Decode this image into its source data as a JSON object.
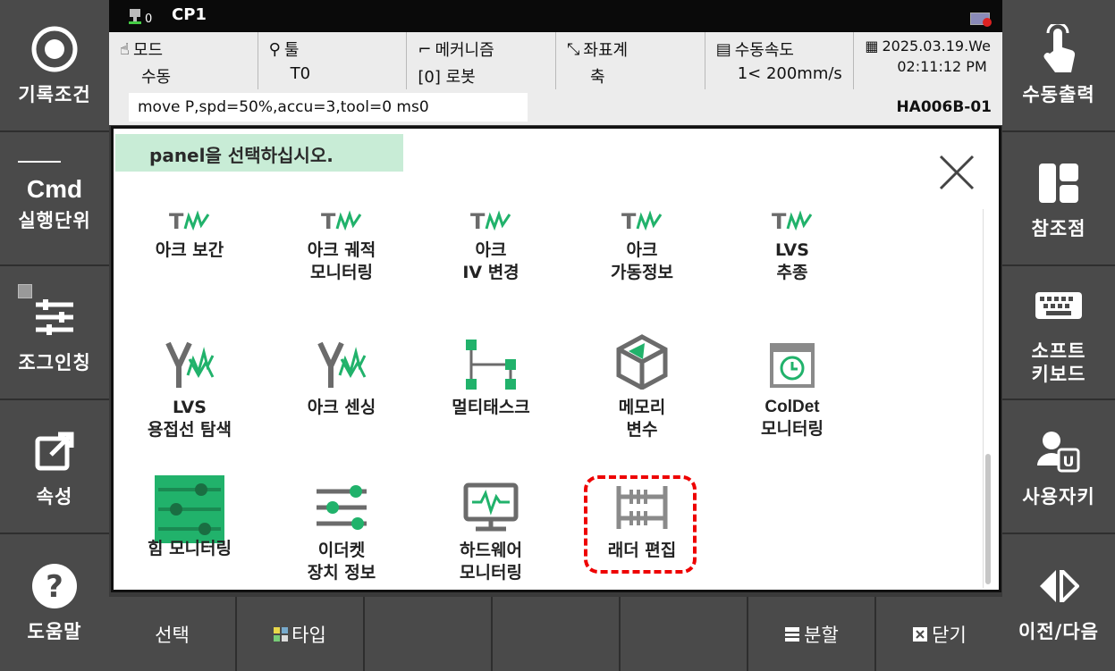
{
  "topbar": {
    "count": "0",
    "title": "CP1"
  },
  "status": [
    {
      "label": "모드",
      "value": "수동",
      "icon": "hand-icon"
    },
    {
      "label": "툴",
      "value": "T0",
      "icon": "wrench-icon"
    },
    {
      "label": "메커니즘",
      "value": "[0] 로봇",
      "icon": "robot-arm-icon"
    },
    {
      "label": "좌표계",
      "value": "축",
      "icon": "axis-icon"
    },
    {
      "label": "수동속도",
      "value": "1< 200mm/s",
      "icon": "speed-icon"
    },
    {
      "label": "2025.03.19.We",
      "value": "02:11:12 PM",
      "icon": "calendar-icon"
    }
  ],
  "command": "move P,spd=50%,accu=3,tool=0 ms0",
  "model": "HA006B-01",
  "left_buttons": [
    "기록조건",
    "실행단위",
    "조그인칭",
    "속성",
    "도움말"
  ],
  "cmd_icon_text": "Cmd",
  "right_buttons": [
    "수동출력",
    "참조점",
    "소프트\n키보드",
    "사용자키",
    "이전/다음"
  ],
  "dialog": {
    "prompt": "panel을 선택하십시오.",
    "items": [
      "아크 보간",
      "아크 궤적\n모니터링",
      "아크\nIV 변경",
      "아크\n가동정보",
      "LVS\n추종",
      "LVS\n용접선 탐색",
      "아크 센싱",
      "멀티태스크",
      "메모리\n변수",
      "ColDet\n모니터링",
      "힘 모니터링",
      "이더켓\n장치 정보",
      "하드웨어\n모니터링",
      "래더 편집"
    ]
  },
  "bottom_buttons": [
    "선택",
    "타입",
    "",
    "",
    "",
    "분할",
    "닫기"
  ],
  "colors": {
    "accent_green": "#21b26b",
    "icon_gray": "#6b6b6b",
    "highlight": "#e00000"
  }
}
